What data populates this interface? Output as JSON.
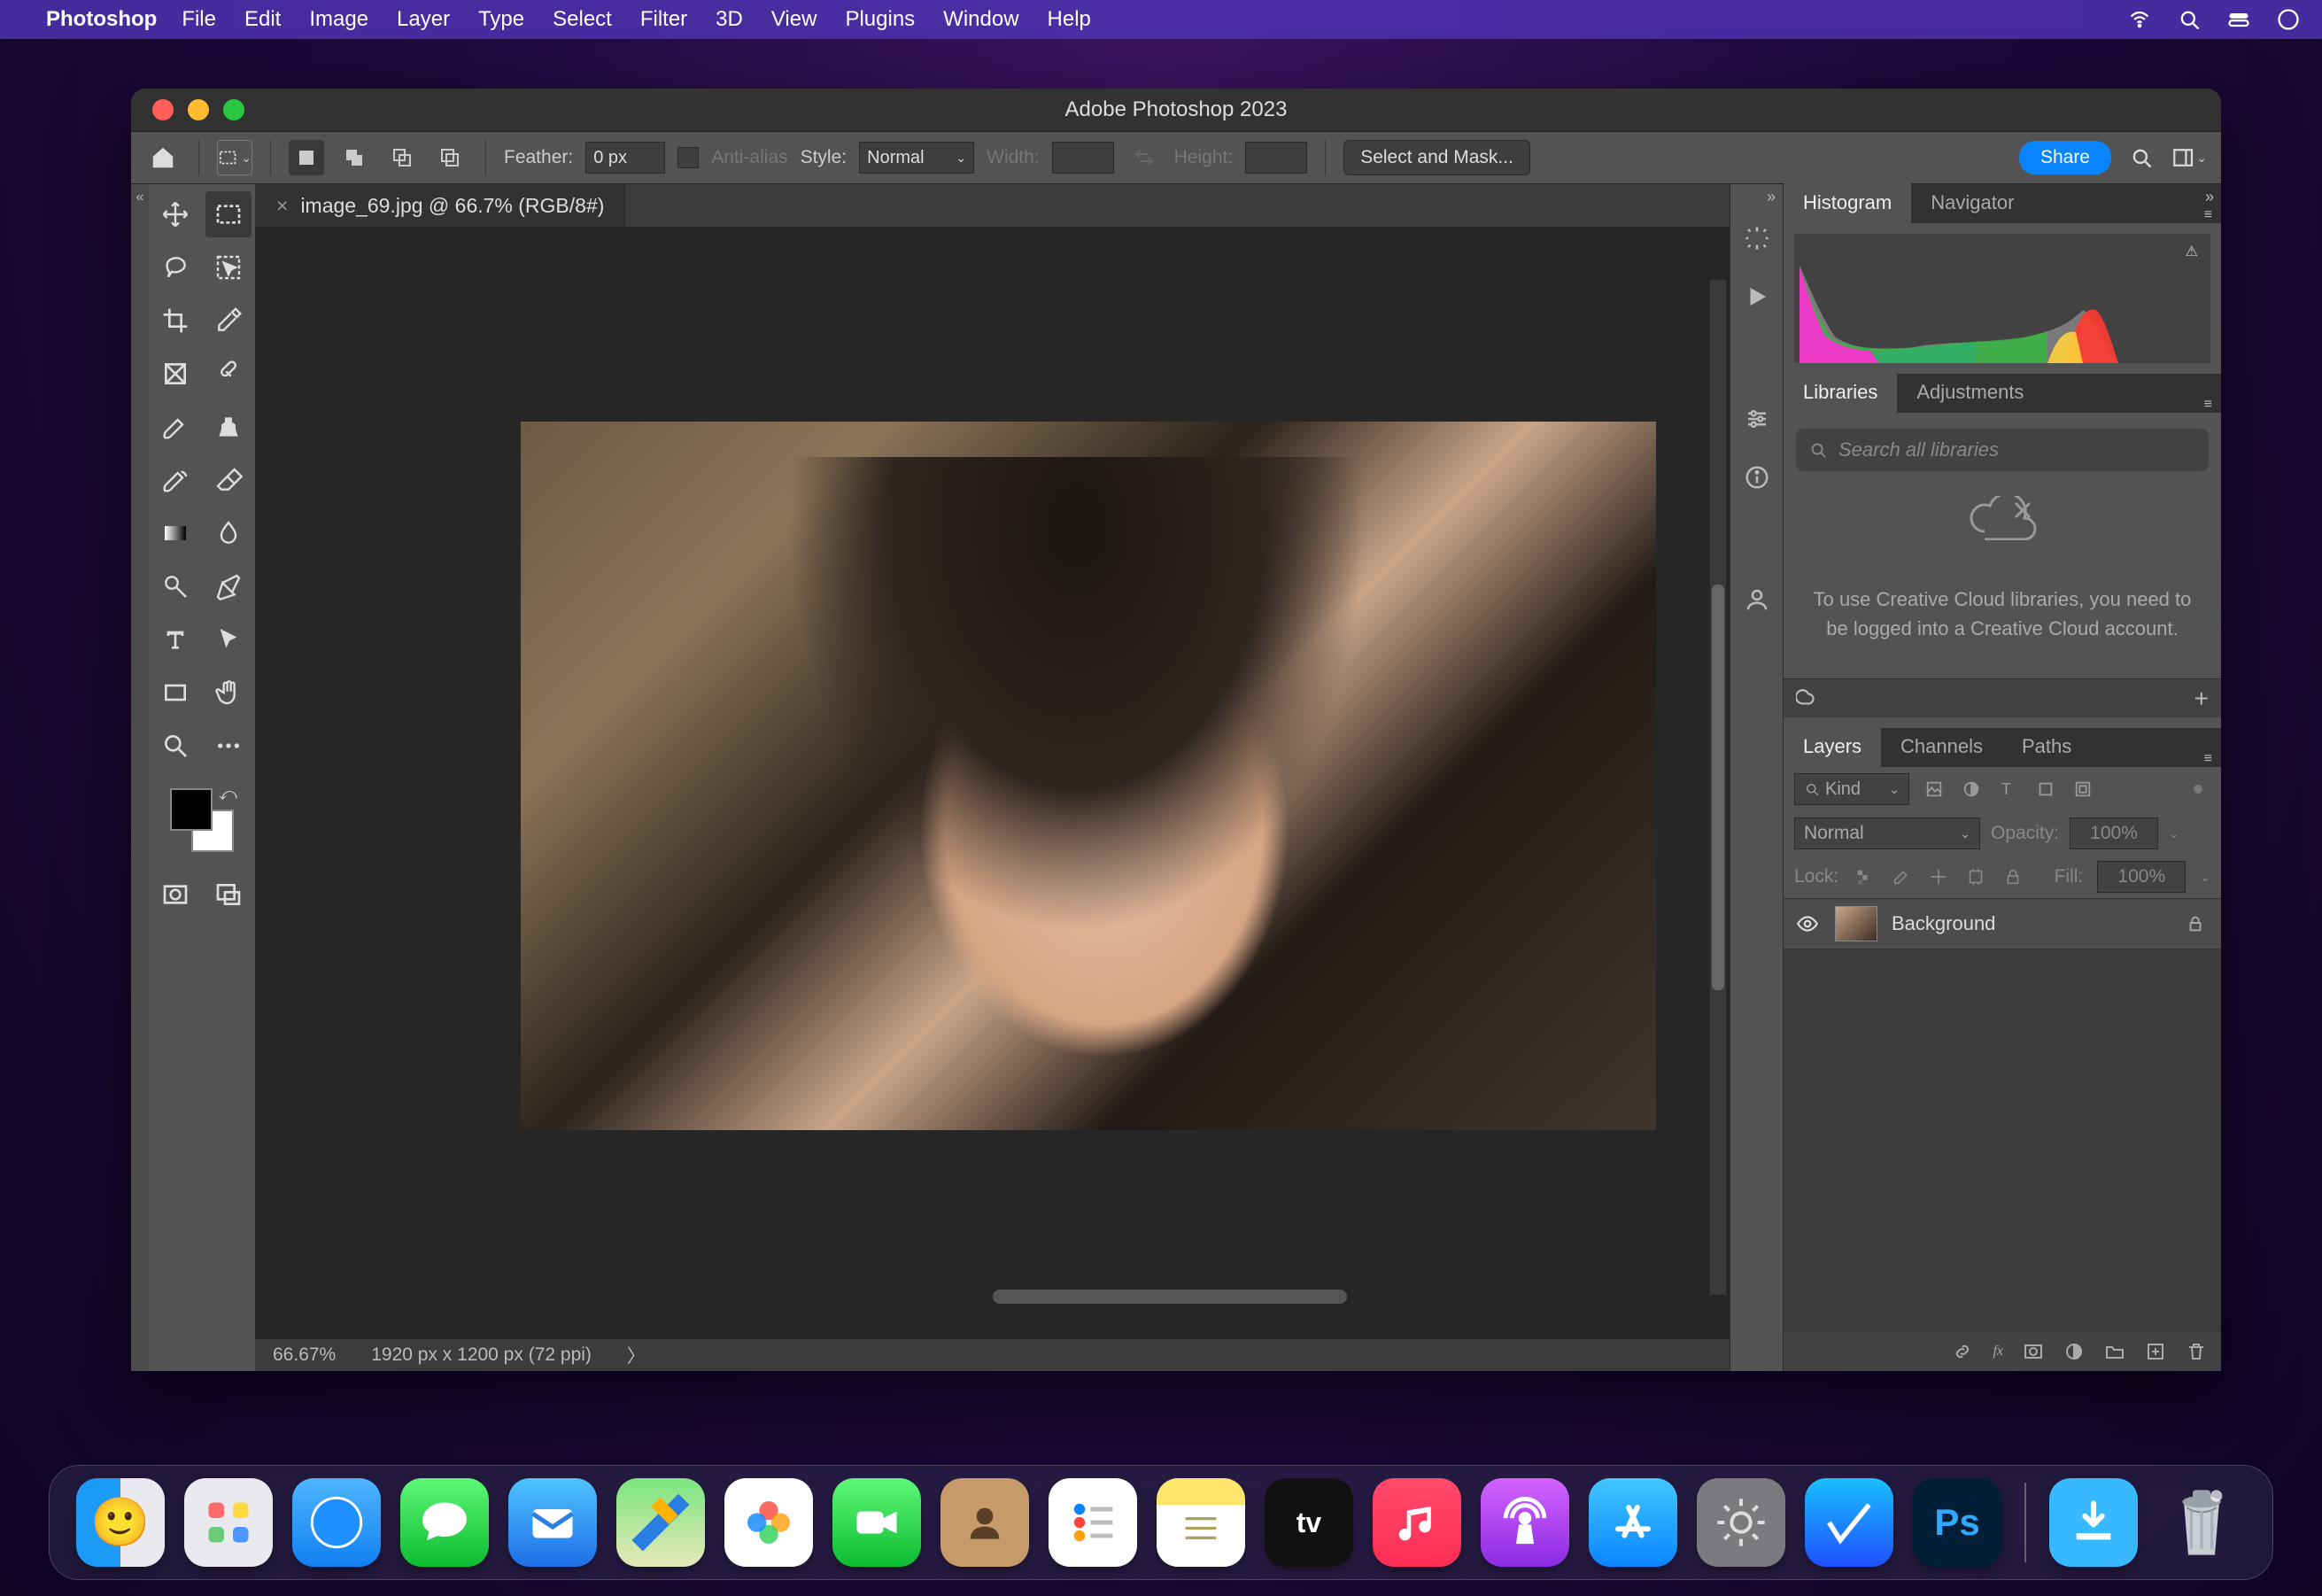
{
  "mac_menu": {
    "app_name": "Photoshop",
    "items": [
      "File",
      "Edit",
      "Image",
      "Layer",
      "Type",
      "Select",
      "Filter",
      "3D",
      "View",
      "Plugins",
      "Window",
      "Help"
    ]
  },
  "window": {
    "title": "Adobe Photoshop 2023"
  },
  "options_bar": {
    "feather_label": "Feather:",
    "feather_value": "0 px",
    "anti_alias_label": "Anti-alias",
    "style_label": "Style:",
    "style_value": "Normal",
    "width_label": "Width:",
    "height_label": "Height:",
    "select_mask": "Select and Mask...",
    "share": "Share"
  },
  "document": {
    "tab_title": "image_69.jpg @ 66.7% (RGB/8#)",
    "zoom": "66.67%",
    "info": "1920 px x 1200 px (72 ppi)"
  },
  "panels": {
    "histogram_tab": "Histogram",
    "navigator_tab": "Navigator",
    "libraries_tab": "Libraries",
    "adjustments_tab": "Adjustments",
    "lib_search_placeholder": "Search all libraries",
    "lib_empty_text": "To use Creative Cloud libraries, you need to be logged into a Creative Cloud account.",
    "layers_tab": "Layers",
    "channels_tab": "Channels",
    "paths_tab": "Paths",
    "kind_label": "Kind",
    "blend_mode": "Normal",
    "opacity_label": "Opacity:",
    "opacity_value": "100%",
    "lock_label": "Lock:",
    "fill_label": "Fill:",
    "fill_value": "100%",
    "layer_name": "Background"
  },
  "dock": {
    "apps": [
      "Finder",
      "Launchpad",
      "Safari",
      "Messages",
      "Mail",
      "Maps",
      "Photos",
      "FaceTime",
      "Contacts",
      "Reminders",
      "Notes",
      "TV",
      "Music",
      "Podcasts",
      "App Store",
      "System Settings",
      "Screenshot",
      "Photoshop"
    ],
    "right": [
      "Downloads",
      "Trash"
    ]
  }
}
